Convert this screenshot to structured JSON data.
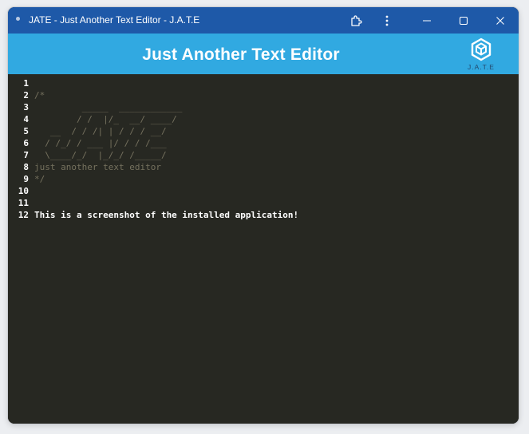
{
  "window": {
    "title": "JATE - Just Another Text Editor - J.A.T.E",
    "icons": [
      "app-dot-icon",
      "extension-icon",
      "more-vert-icon",
      "minimize-icon",
      "maximize-icon",
      "close-icon"
    ]
  },
  "header": {
    "title": "Just Another Text Editor",
    "logo_text": "J.A.T.E",
    "logo_icon": "jate-logo-icon"
  },
  "editor": {
    "line_numbers": [
      "1",
      "2",
      "3",
      "4",
      "5",
      "6",
      "7",
      "8",
      "9",
      "10",
      "11",
      "12"
    ],
    "lines": [
      "",
      "/*",
      "         _____  ____________",
      "        / /  |/_  __/ ____/",
      "   __  / / /| | / / / __/",
      "  / /_/ / ___ |/ / / /___",
      "  \\____/_/  |_/_/ /_____/",
      "just another text editor",
      "*/",
      "",
      "",
      "This is a screenshot of the installed application!"
    ]
  },
  "colors": {
    "titlebar": "#1e59a8",
    "header": "#31a9e1",
    "editor_bg": "#272822",
    "comment": "#75715e",
    "text": "#ffffff"
  }
}
